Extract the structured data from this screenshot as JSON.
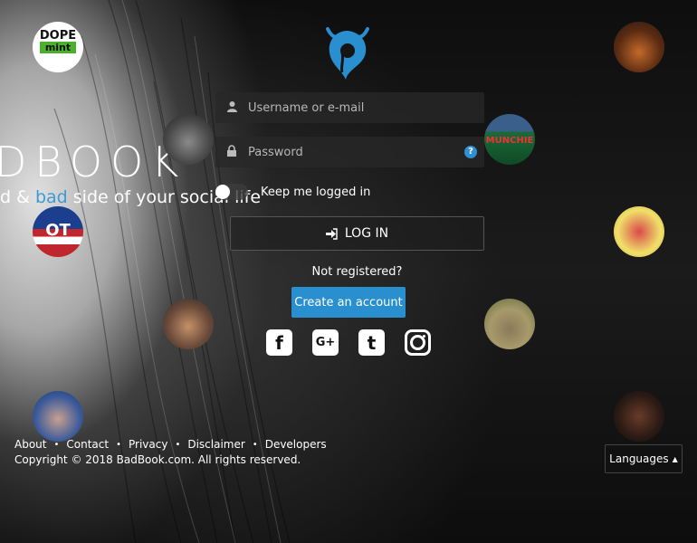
{
  "brand": {
    "title": "DBOOK",
    "tag_pre": "d & ",
    "tag_accent": "bad",
    "tag_post": " side of your social life"
  },
  "login": {
    "username_placeholder": "Username or e-mail",
    "password_placeholder": "Password",
    "remember_label": "Keep me logged in",
    "login_label": "LOG IN",
    "not_registered": "Not registered?",
    "create_label": "Create an account"
  },
  "social": {
    "facebook": "f",
    "google": "G+",
    "twitter": "t"
  },
  "avatars": {
    "dope_line1": "DOPE",
    "dope_line2": "mint",
    "munchies": "MUNCHIE",
    "ot": "OT"
  },
  "footer": {
    "links": [
      "About",
      "Contact",
      "Privacy",
      "Disclaimer",
      "Developers"
    ],
    "separator": "•",
    "copyright": "Copyright © 2018 BadBook.com. All rights reserved."
  },
  "languages": {
    "label": "Languages"
  },
  "colors": {
    "accent": "#2a8fcf",
    "accent_text": "#3a9bd5"
  }
}
